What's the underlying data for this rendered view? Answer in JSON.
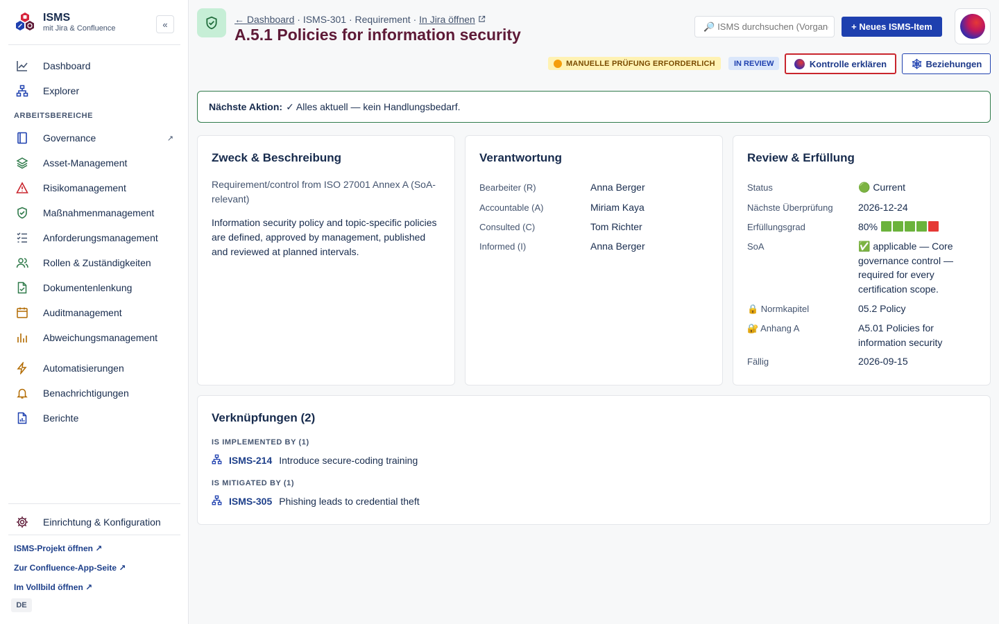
{
  "brand": {
    "title": "ISMS",
    "subtitle": "mit Jira & Confluence",
    "collapse": "«"
  },
  "nav": {
    "dashboard": "Dashboard",
    "explorer": "Explorer",
    "section": "ARBEITSBEREICHE",
    "items": [
      {
        "label": "Governance",
        "icon": "book-icon",
        "ext": "↗"
      },
      {
        "label": "Asset-Management",
        "icon": "layers-icon"
      },
      {
        "label": "Risikomanagement",
        "icon": "warning-icon"
      },
      {
        "label": "Maßnahmenmanagement",
        "icon": "shield-check-icon"
      },
      {
        "label": "Anforderungsmanagement",
        "icon": "checklist-icon"
      },
      {
        "label": "Rollen & Zuständigkeiten",
        "icon": "people-icon"
      },
      {
        "label": "Dokumentenlenkung",
        "icon": "document-check-icon"
      },
      {
        "label": "Auditmanagement",
        "icon": "calendar-icon"
      },
      {
        "label": "Abweichungsmanagement",
        "icon": "bar-chart-icon"
      }
    ],
    "automation": "Automatisierungen",
    "notifications": "Benachrichtigungen",
    "reports": "Berichte",
    "setup": "Einrichtung & Konfiguration"
  },
  "footer": {
    "project": "ISMS-Projekt öffnen ↗",
    "confluence": "Zur Confluence-App-Seite ↗",
    "fullscreen": "Im Vollbild öffnen ↗",
    "lang": "DE"
  },
  "header": {
    "back": "← Dashboard",
    "key": " · ISMS-301 · Requirement · ",
    "jira": "In Jira öffnen",
    "title": "A.5.1 Policies for information security",
    "search_placeholder": "ISMS durchsuchen (Vorgang, Key…)",
    "new_button": "+ Neues ISMS-Item",
    "badge_manual": "MANUELLE PRÜFUNG ERFORDERLICH",
    "badge_review": "IN REVIEW",
    "explain": "Kontrolle erklären",
    "relations": "Beziehungen"
  },
  "next_action": {
    "label": "Nächste Aktion:",
    "text": "✓ Alles aktuell — kein Handlungsbedarf."
  },
  "purpose": {
    "title": "Zweck & Beschreibung",
    "intro": "Requirement/control from ISO 27001 Annex A (SoA-relevant)",
    "body": "Information security policy and topic-specific policies are defined, approved by management, published and reviewed at planned intervals."
  },
  "responsibility": {
    "title": "Verantwortung",
    "rows": [
      {
        "label": "Bearbeiter (R)",
        "value": "Anna Berger"
      },
      {
        "label": "Accountable (A)",
        "value": "Miriam Kaya"
      },
      {
        "label": "Consulted (C)",
        "value": "Tom Richter"
      },
      {
        "label": "Informed (I)",
        "value": "Anna Berger"
      }
    ]
  },
  "review": {
    "title": "Review & Erfüllung",
    "status_label": "Status",
    "status_value": "🟢 Current",
    "next_label": "Nächste Überprüfung",
    "next_value": "2026-12-24",
    "fulfil_label": "Erfüllungsgrad",
    "fulfil_value": "80%",
    "fulfilment_pct": 80,
    "soa_label": "SoA",
    "soa_value": "✅ applicable — Core governance control — required for every certification scope.",
    "chapter_label": "🔒 Normkapitel",
    "chapter_value": "05.2 Policy",
    "annex_label": "🔐 Anhang A",
    "annex_value": "A5.01 Policies for information security",
    "due_label": "Fällig",
    "due_value": "2026-09-15"
  },
  "links": {
    "title": "Verknüpfungen (2)",
    "groups": [
      {
        "heading": "IS IMPLEMENTED BY (1)",
        "key": "ISMS-214",
        "summary": "Introduce secure-coding training"
      },
      {
        "heading": "IS MITIGATED BY (1)",
        "key": "ISMS-305",
        "summary": "Phishing leads to credential theft"
      }
    ]
  },
  "colors": {
    "accent": "#1e40af",
    "title": "#5e1a37",
    "success": "#2f7a4a",
    "danger": "#c9252d"
  }
}
